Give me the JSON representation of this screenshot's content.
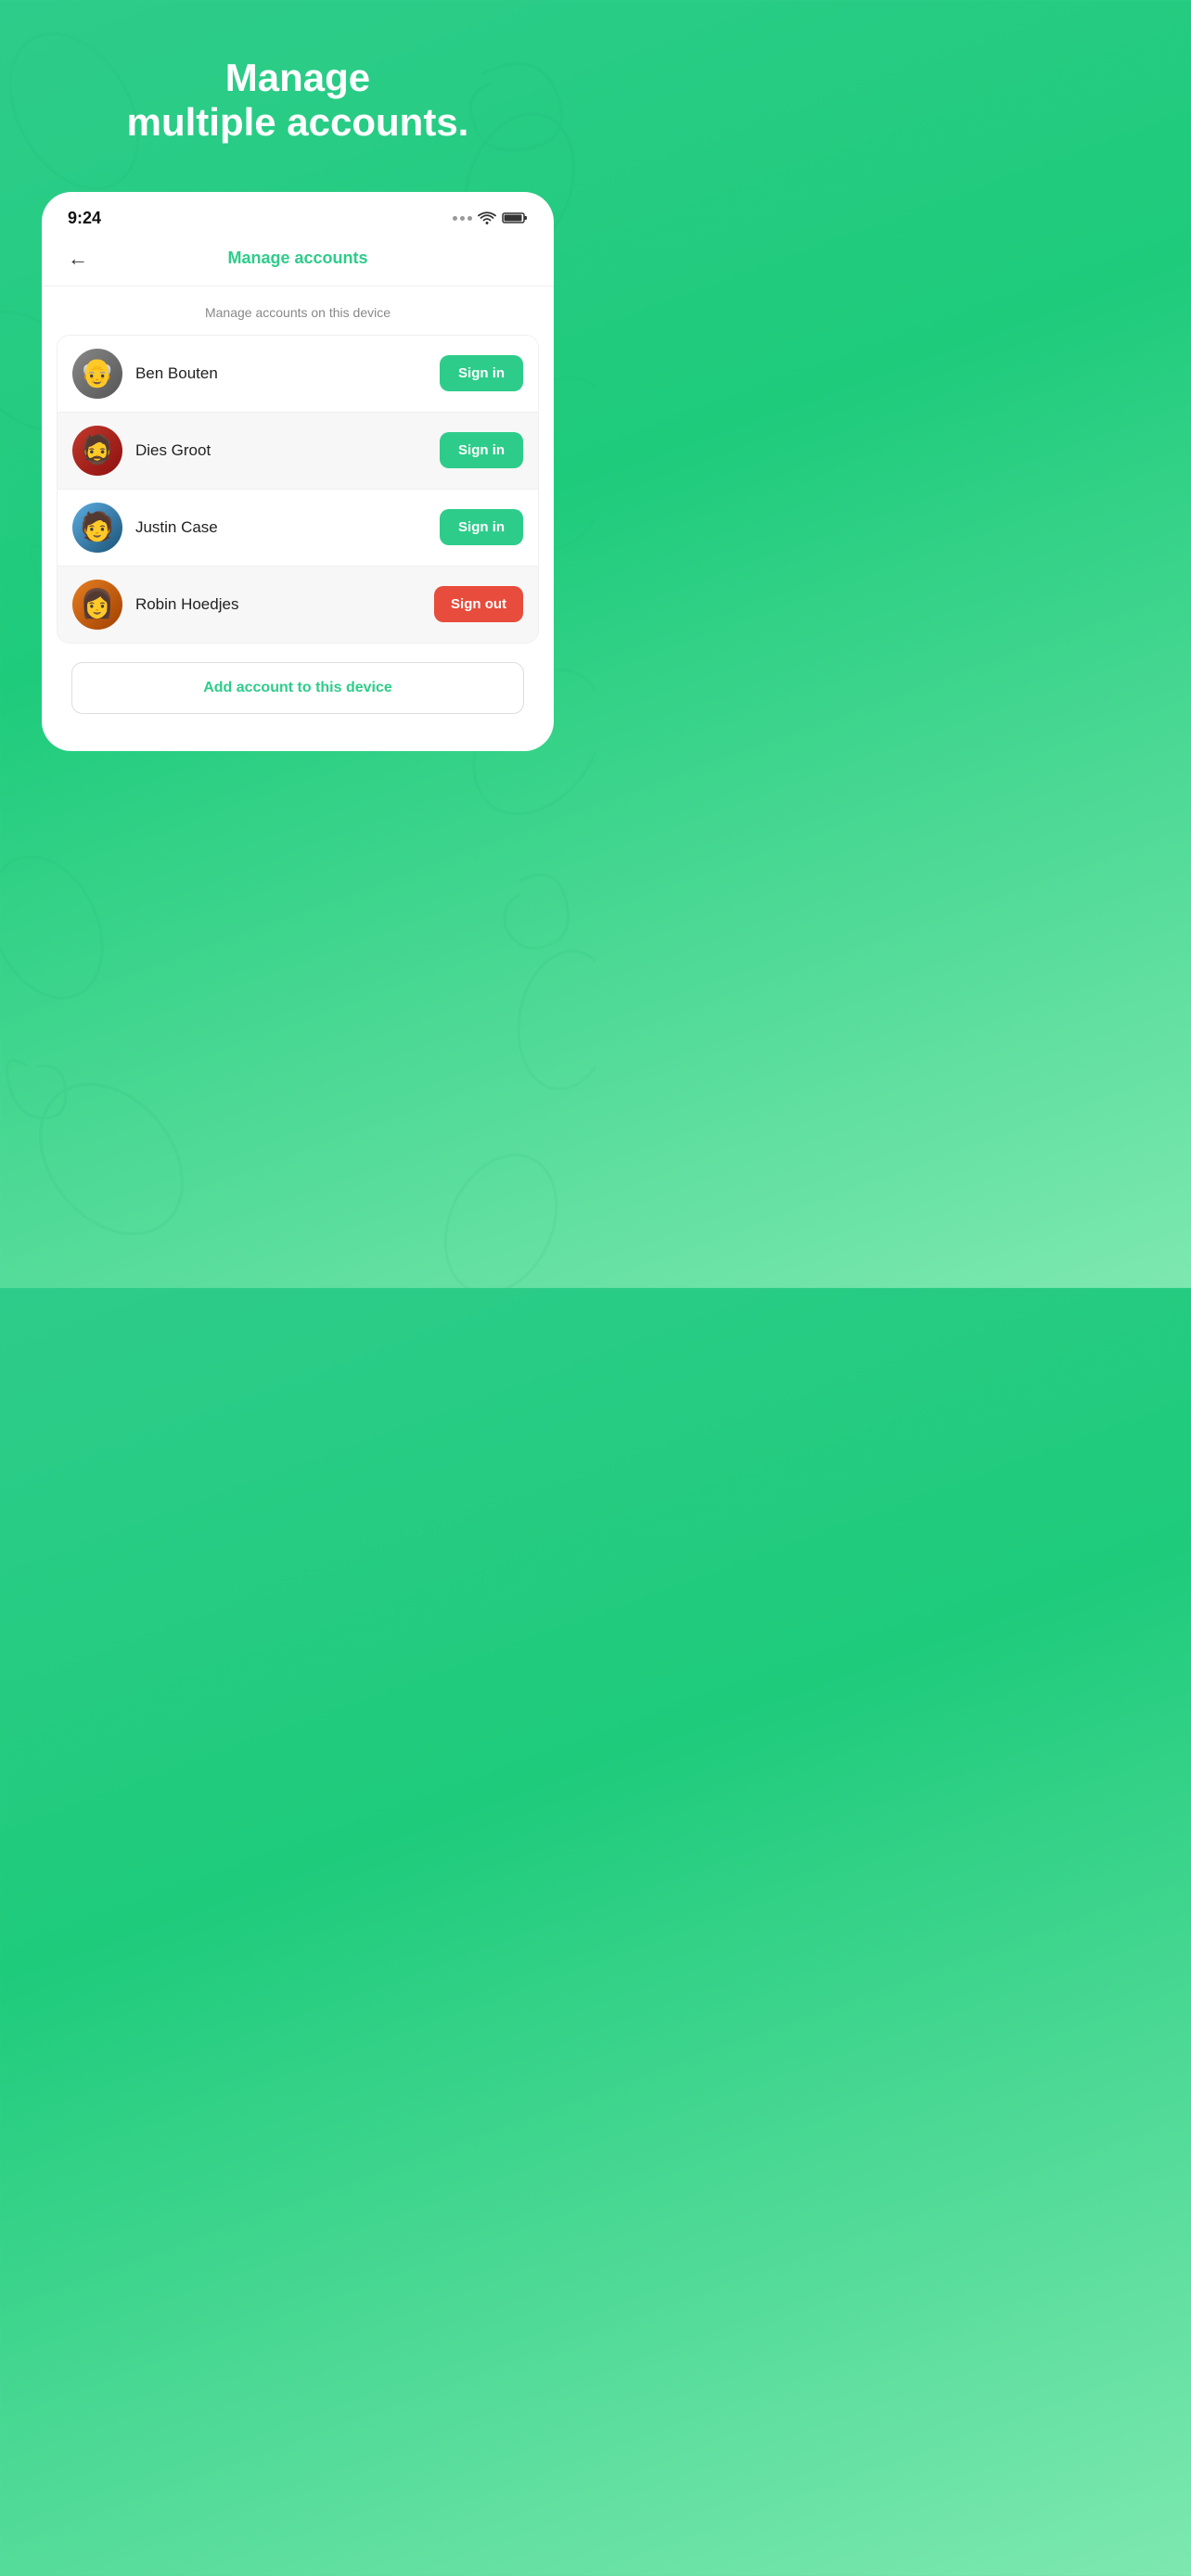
{
  "background": {
    "gradient_start": "#2ecc8a",
    "gradient_end": "#7de8b0"
  },
  "header": {
    "title_line1": "Manage",
    "title_line2": "multiple accounts."
  },
  "status_bar": {
    "time": "9:24"
  },
  "nav": {
    "back_label": "←",
    "title": "Manage accounts"
  },
  "section_label": "Manage accounts on this device",
  "accounts": [
    {
      "name": "Ben Bouten",
      "action": "Sign in",
      "action_type": "signin",
      "shaded": false,
      "avatar_class": "avatar-ben"
    },
    {
      "name": "Dies Groot",
      "action": "Sign in",
      "action_type": "signin",
      "shaded": true,
      "avatar_class": "avatar-dies"
    },
    {
      "name": "Justin Case",
      "action": "Sign in",
      "action_type": "signin",
      "shaded": false,
      "avatar_class": "avatar-justin"
    },
    {
      "name": "Robin Hoedjes",
      "action": "Sign out",
      "action_type": "signout",
      "shaded": true,
      "avatar_class": "avatar-robin"
    }
  ],
  "add_account_label": "Add account to this device"
}
